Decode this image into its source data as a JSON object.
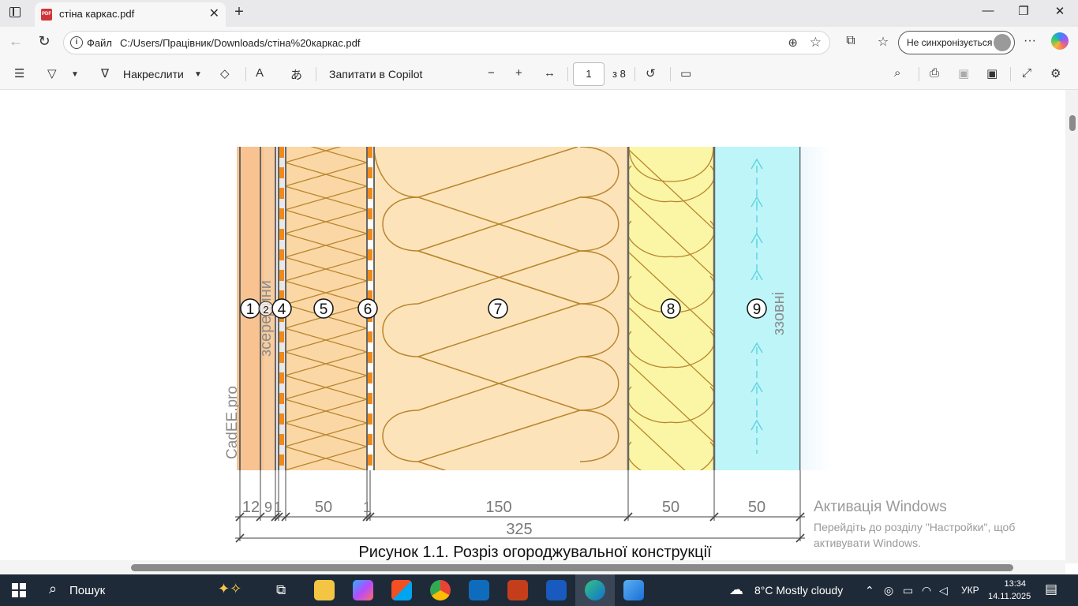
{
  "browser": {
    "tab_title": "стіна каркас.pdf",
    "url_scheme": "Файл",
    "url": "C:/Users/Працівник/Downloads/стіна%20каркас.pdf",
    "profile_label": "Не синхронізується"
  },
  "pdf_toolbar": {
    "draw_label": "Накреслити",
    "copilot_label": "Запитати в Copilot",
    "page_current": "1",
    "page_total": "з 8"
  },
  "drawing": {
    "layer_numbers": [
      "1",
      "2",
      "4",
      "5",
      "6",
      "7",
      "8",
      "9"
    ],
    "inside_label": "зсередини",
    "outside_label": "ззовні",
    "watermark": "CadEE.pro",
    "dimensions": [
      "12",
      "9",
      "1",
      "50",
      "1",
      "150",
      "50",
      "50"
    ],
    "total_dimension": "325",
    "caption": "Рисунок 1.1. Розріз огороджувальної конструкції"
  },
  "activation": {
    "title": "Активація Windows",
    "line1": "Перейдіть до розділу \"Настройки\", щоб",
    "line2": "активувати Windows."
  },
  "taskbar": {
    "search_label": "Пошук",
    "weather": "8°C  Mostly cloudy",
    "language": "УКР",
    "time": "13:34",
    "date": "14.11.2025"
  }
}
